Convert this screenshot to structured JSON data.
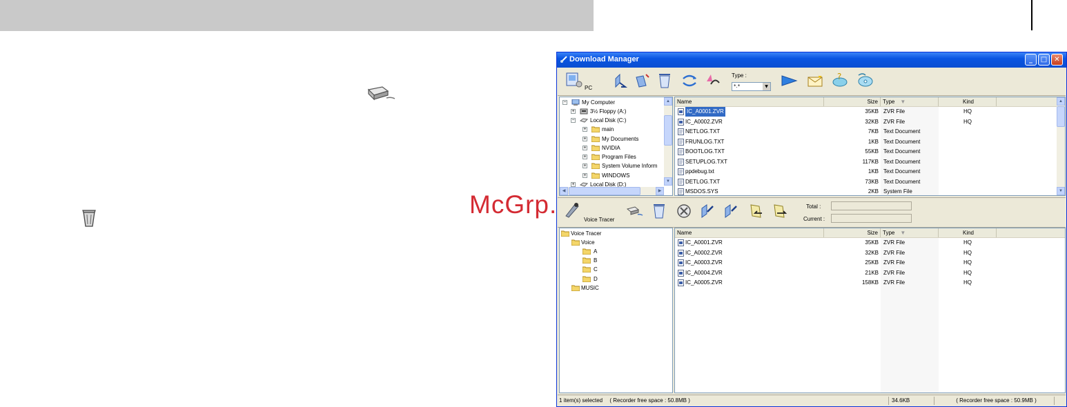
{
  "watermark": "McGrp.Ru",
  "window": {
    "title": "Download Manager",
    "buttons": {
      "minimize": "_",
      "maximize": "□",
      "close": "✕"
    }
  },
  "top_toolbar": {
    "pc_label": "PC",
    "type_label": "Type :",
    "type_value": "*.*",
    "icons": [
      "pc-icon",
      "upload-icon",
      "download-icon",
      "delete-icon",
      "sync-icon",
      "undo-icon",
      "play-icon",
      "mail-icon",
      "help-icon",
      "cd-icon"
    ]
  },
  "pc_tree": {
    "items": [
      {
        "label": "My Computer",
        "expander": "−"
      },
      {
        "label": "3½ Floppy (A:)",
        "expander": "+"
      },
      {
        "label": "Local Disk (C:)",
        "expander": "−"
      },
      {
        "label": "main",
        "expander": "+"
      },
      {
        "label": "My Documents",
        "expander": "+"
      },
      {
        "label": "NVIDIA",
        "expander": "+"
      },
      {
        "label": "Program Files",
        "expander": "+"
      },
      {
        "label": "System Volume Inform",
        "expander": "+"
      },
      {
        "label": "WINDOWS",
        "expander": "+"
      },
      {
        "label": "Local Disk (D:)",
        "expander": "+"
      }
    ]
  },
  "pc_list": {
    "headers": {
      "name": "Name",
      "size": "Size",
      "type": "Type",
      "kind": "Kind"
    },
    "rows": [
      {
        "name": "IC_A0001.ZVR",
        "size": "35KB",
        "type": "ZVR File",
        "kind": "HQ",
        "selected": true
      },
      {
        "name": "IC_A0002.ZVR",
        "size": "32KB",
        "type": "ZVR File",
        "kind": "HQ"
      },
      {
        "name": "NETLOG.TXT",
        "size": "7KB",
        "type": "Text Document",
        "kind": ""
      },
      {
        "name": "FRUNLOG.TXT",
        "size": "1KB",
        "type": "Text Document",
        "kind": ""
      },
      {
        "name": "BOOTLOG.TXT",
        "size": "55KB",
        "type": "Text Document",
        "kind": ""
      },
      {
        "name": "SETUPLOG.TXT",
        "size": "117KB",
        "type": "Text Document",
        "kind": ""
      },
      {
        "name": "ppdebug.txt",
        "size": "1KB",
        "type": "Text Document",
        "kind": ""
      },
      {
        "name": "DETLOG.TXT",
        "size": "73KB",
        "type": "Text Document",
        "kind": ""
      },
      {
        "name": "MSDOS.SYS",
        "size": "2KB",
        "type": "System File",
        "kind": ""
      }
    ]
  },
  "bottom_toolbar": {
    "device_label": "Voice Tracer",
    "total_label": "Total :",
    "current_label": "Current :",
    "icons": [
      "voice-tracer-icon",
      "eraser-icon",
      "trash-icon",
      "stop-icon",
      "upload-icon",
      "download-icon",
      "back-icon",
      "forward-icon"
    ]
  },
  "device_tree": {
    "items": [
      {
        "label": "Voice Tracer"
      },
      {
        "label": "Voice"
      },
      {
        "label": "A"
      },
      {
        "label": "B"
      },
      {
        "label": "C"
      },
      {
        "label": "D"
      },
      {
        "label": "MUSIC"
      }
    ]
  },
  "device_list": {
    "headers": {
      "name": "Name",
      "size": "Size",
      "type": "Type",
      "kind": "Kind"
    },
    "rows": [
      {
        "name": "IC_A0001.ZVR",
        "size": "35KB",
        "type": "ZVR File",
        "kind": "HQ"
      },
      {
        "name": "IC_A0002.ZVR",
        "size": "32KB",
        "type": "ZVR File",
        "kind": "HQ"
      },
      {
        "name": "IC_A0003.ZVR",
        "size": "25KB",
        "type": "ZVR File",
        "kind": "HQ"
      },
      {
        "name": "IC_A0004.ZVR",
        "size": "21KB",
        "type": "ZVR File",
        "kind": "HQ"
      },
      {
        "name": "IC_A0005.ZVR",
        "size": "158KB",
        "type": "ZVR File",
        "kind": "HQ"
      }
    ]
  },
  "status_bar": {
    "selection": "1 item(s) selected",
    "left_free": "( Recorder free space : 50.8MB )",
    "size": "34.6KB",
    "right_free": "( Recorder free space : 50.9MB )"
  },
  "colors": {
    "title_blue": "#0a55e2",
    "selection": "#316ac5",
    "watermark_red": "#d42b33",
    "header_gray": "#c9c9c9"
  }
}
